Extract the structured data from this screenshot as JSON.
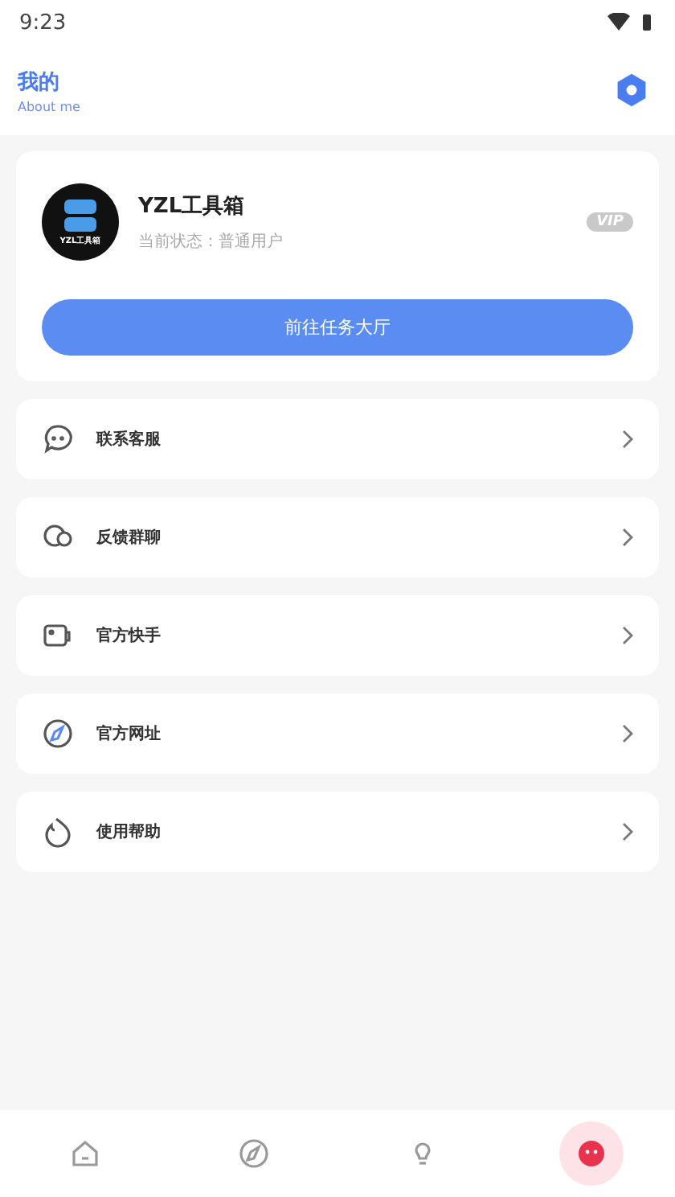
{
  "status_bar": {
    "time": "9:23"
  },
  "header": {
    "title": "我的",
    "subtitle": "About me"
  },
  "profile": {
    "name": "YZL工具箱",
    "status": "当前状态：普通用户",
    "badge": "VIP",
    "avatar_text": "YZL工具箱",
    "button": "前往任务大厅"
  },
  "menu": [
    {
      "kind": "chat",
      "label": "联系客服"
    },
    {
      "kind": "group",
      "label": "反馈群聊"
    },
    {
      "kind": "card",
      "label": "官方快手"
    },
    {
      "kind": "compass",
      "label": "官方网址"
    },
    {
      "kind": "flame",
      "label": "使用帮助"
    }
  ],
  "tabs": [
    {
      "kind": "home",
      "selected": false
    },
    {
      "kind": "compass",
      "selected": false
    },
    {
      "kind": "bulb",
      "selected": false
    },
    {
      "kind": "me",
      "selected": true
    }
  ]
}
